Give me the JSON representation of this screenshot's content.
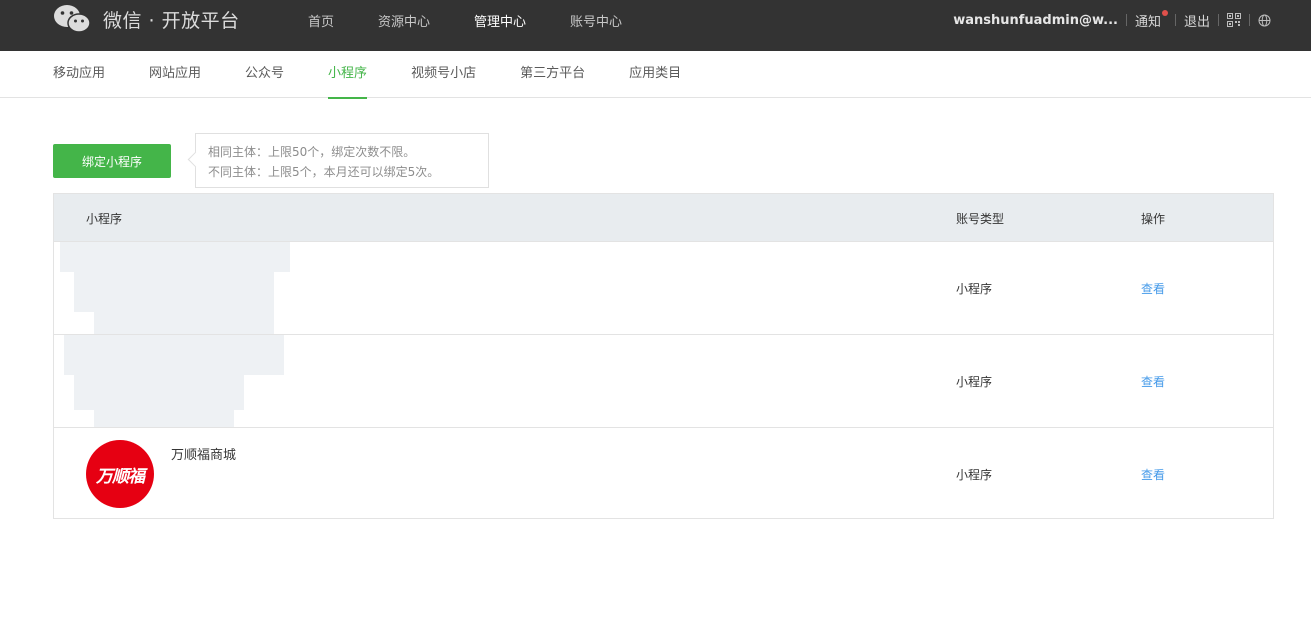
{
  "header": {
    "platform_name": "微信 · 开放平台",
    "nav": [
      {
        "label": "首页",
        "active": false
      },
      {
        "label": "资源中心",
        "active": false
      },
      {
        "label": "管理中心",
        "active": true
      },
      {
        "label": "账号中心",
        "active": false
      }
    ],
    "user": "wanshunfuadmin@w...",
    "notify_label": "通知",
    "logout_label": "退出",
    "icons": [
      "wechat-logo-icon",
      "qrcode-icon",
      "globe-icon"
    ]
  },
  "subnav": {
    "items": [
      {
        "label": "移动应用",
        "active": false
      },
      {
        "label": "网站应用",
        "active": false
      },
      {
        "label": "公众号",
        "active": false
      },
      {
        "label": "小程序",
        "active": true
      },
      {
        "label": "视频号小店",
        "active": false
      },
      {
        "label": "第三方平台",
        "active": false
      },
      {
        "label": "应用类目",
        "active": false
      }
    ]
  },
  "bind": {
    "button_label": "绑定小程序",
    "tip_line1": "相同主体：上限50个，绑定次数不限。",
    "tip_line2": "不同主体：上限5个，本月还可以绑定5次。"
  },
  "table": {
    "headers": {
      "name": "小程序",
      "type": "账号类型",
      "op": "操作"
    },
    "rows": [
      {
        "name": "",
        "type": "小程序",
        "op": "查看",
        "redacted": true
      },
      {
        "name": "",
        "type": "小程序",
        "op": "查看",
        "redacted": true
      },
      {
        "name": "万顺福商城",
        "type": "小程序",
        "op": "查看",
        "avatar_text": "万顺福",
        "redacted": false
      }
    ]
  },
  "colors": {
    "topbar": "#333333",
    "accent": "#44b549",
    "link": "#459ae9",
    "table_header": "#e8ecef",
    "avatar_red": "#e60012",
    "notify_dot": "#e0504b"
  }
}
